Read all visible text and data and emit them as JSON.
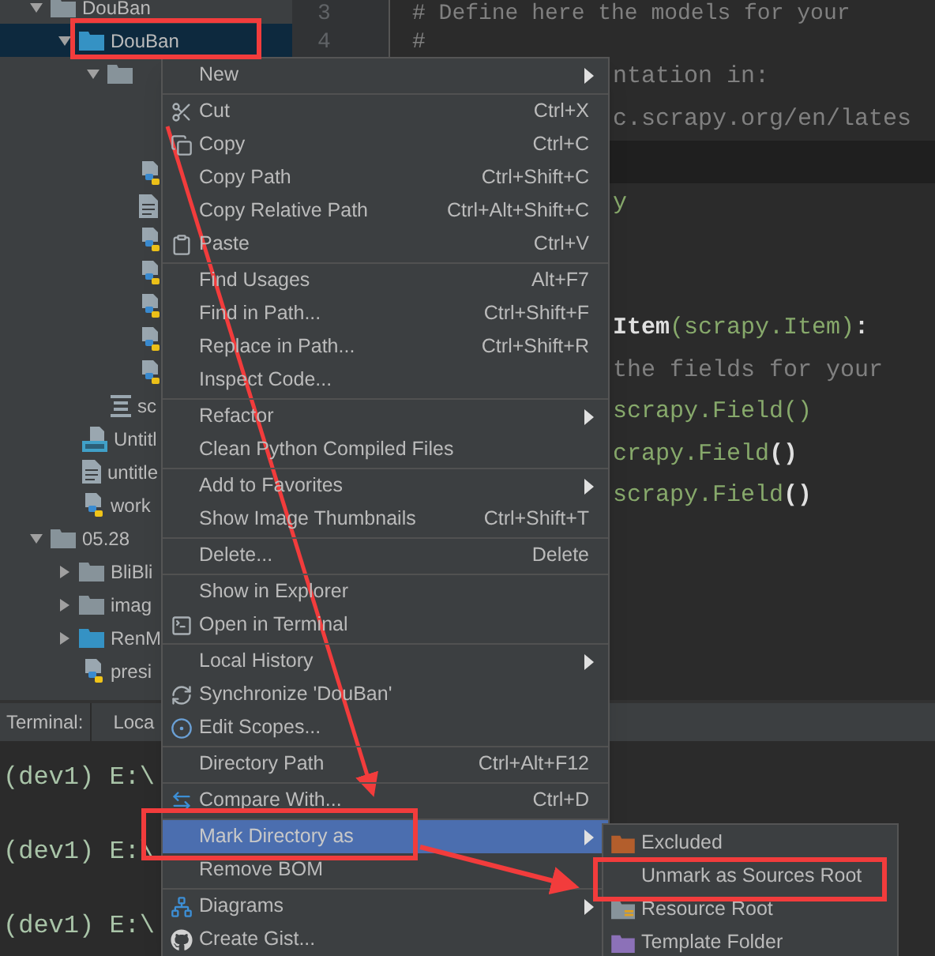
{
  "project_tree": [
    {
      "name": "DouBan",
      "kind": "folder",
      "expanded": true,
      "selected": false,
      "children": [
        {
          "name": "DouBan",
          "kind": "source-folder",
          "expanded": true,
          "selected": true,
          "children": [
            {
              "kind": "folder",
              "expanded": true,
              "selected": false,
              "children": [
                {
                  "kind": "covered"
                },
                {
                  "kind": "covered"
                },
                {
                  "kind": "python-file",
                  "selected": false
                },
                {
                  "kind": "text-file",
                  "selected": false
                },
                {
                  "kind": "python-file",
                  "selected": false
                },
                {
                  "kind": "python-file",
                  "selected": false
                },
                {
                  "kind": "python-file",
                  "selected": false
                },
                {
                  "kind": "python-file",
                  "selected": false
                },
                {
                  "kind": "python-file",
                  "selected": false
                }
              ]
            },
            {
              "name": "sc",
              "kind": "config-file",
              "selected": false
            }
          ]
        },
        {
          "name": "Untitl",
          "kind": "notebook-file",
          "selected": false
        },
        {
          "name": "untitle",
          "kind": "text-file",
          "selected": false
        },
        {
          "name": "work",
          "kind": "python-file",
          "selected": false
        }
      ]
    },
    {
      "name": "05.28",
      "kind": "folder",
      "expanded": true,
      "selected": false,
      "children": [
        {
          "name": "BliBli",
          "kind": "folder",
          "expanded": false,
          "selected": false
        },
        {
          "name": "imag",
          "kind": "folder",
          "expanded": false,
          "selected": false
        },
        {
          "name": "RenM",
          "kind": "source-folder",
          "expanded": false,
          "selected": false
        },
        {
          "name": "presi",
          "kind": "python-file",
          "selected": false
        }
      ]
    }
  ],
  "editor": {
    "lines": [
      {
        "number": "3",
        "covered": false,
        "current": false,
        "segments": [
          {
            "kind": "comment",
            "text": "# Define here the models for your"
          }
        ]
      },
      {
        "number": "4",
        "covered": false,
        "current": false,
        "segments": [
          {
            "kind": "comment",
            "text": "#"
          }
        ]
      },
      {
        "covered": true,
        "current": false,
        "segments": [
          {
            "kind": "comment",
            "text": "ntation in:"
          }
        ]
      },
      {
        "covered": true,
        "current": false,
        "segments": [
          {
            "kind": "comment",
            "text": "c.scrapy.org/en/lates"
          }
        ]
      },
      {
        "current": true
      },
      {
        "covered": true,
        "current": false,
        "segments": [
          {
            "kind": "plain",
            "text": "y"
          }
        ]
      },
      {
        "current": false
      },
      {
        "current": false
      },
      {
        "covered": true,
        "current": false,
        "segments": [
          {
            "kind": "class",
            "text": "Item"
          },
          {
            "kind": "plain",
            "text": "(scrapy.Item)"
          },
          {
            "kind": "class",
            "text": ":"
          }
        ]
      },
      {
        "covered": true,
        "current": false,
        "segments": [
          {
            "kind": "comment",
            "text": "the fields for your"
          }
        ]
      },
      {
        "covered": true,
        "current": false,
        "segments": [
          {
            "kind": "plain",
            "text": "scrapy.Field()"
          }
        ]
      },
      {
        "covered": true,
        "current": false,
        "segments": [
          {
            "kind": "plain",
            "text": "crapy.Field"
          },
          {
            "kind": "class",
            "text": "()"
          }
        ]
      },
      {
        "covered": true,
        "current": false,
        "segments": [
          {
            "kind": "plain",
            "text": "scrapy.Field"
          },
          {
            "kind": "class",
            "text": "()"
          }
        ]
      }
    ]
  },
  "terminal": {
    "title": "Terminal:",
    "tabs": [
      {
        "label": "Loca",
        "selected": true
      }
    ],
    "lines": [
      "(dev1) E:\\",
      "(dev1) E:\\",
      "(dev1) E:\\"
    ]
  },
  "context_menu": {
    "items": [
      {
        "kind": "item",
        "label": "New",
        "submenu": true,
        "selected": false
      },
      {
        "kind": "separator"
      },
      {
        "kind": "item",
        "label": "Cut",
        "shortcut": "Ctrl+X",
        "submenu": false,
        "selected": false
      },
      {
        "kind": "item",
        "label": "Copy",
        "shortcut": "Ctrl+C",
        "submenu": false,
        "selected": false
      },
      {
        "kind": "item",
        "label": "Copy Path",
        "shortcut": "Ctrl+Shift+C",
        "submenu": false,
        "selected": false
      },
      {
        "kind": "item",
        "label": "Copy Relative Path",
        "shortcut": "Ctrl+Alt+Shift+C",
        "submenu": false,
        "selected": false
      },
      {
        "kind": "item",
        "label": "Paste",
        "shortcut": "Ctrl+V",
        "submenu": false,
        "selected": false
      },
      {
        "kind": "separator"
      },
      {
        "kind": "item",
        "label": "Find Usages",
        "shortcut": "Alt+F7",
        "submenu": false,
        "selected": false
      },
      {
        "kind": "item",
        "label": "Find in Path...",
        "shortcut": "Ctrl+Shift+F",
        "submenu": false,
        "selected": false
      },
      {
        "kind": "item",
        "label": "Replace in Path...",
        "shortcut": "Ctrl+Shift+R",
        "submenu": false,
        "selected": false
      },
      {
        "kind": "item",
        "label": "Inspect Code...",
        "submenu": false,
        "selected": false
      },
      {
        "kind": "separator"
      },
      {
        "kind": "item",
        "label": "Refactor",
        "submenu": true,
        "selected": false
      },
      {
        "kind": "item",
        "label": "Clean Python Compiled Files",
        "submenu": false,
        "selected": false
      },
      {
        "kind": "separator"
      },
      {
        "kind": "item",
        "label": "Add to Favorites",
        "submenu": true,
        "selected": false
      },
      {
        "kind": "item",
        "label": "Show Image Thumbnails",
        "shortcut": "Ctrl+Shift+T",
        "submenu": false,
        "selected": false
      },
      {
        "kind": "separator"
      },
      {
        "kind": "item",
        "label": "Delete...",
        "shortcut": "Delete",
        "submenu": false,
        "selected": false
      },
      {
        "kind": "separator"
      },
      {
        "kind": "item",
        "label": "Show in Explorer",
        "submenu": false,
        "selected": false
      },
      {
        "kind": "item",
        "label": "Open in Terminal",
        "submenu": false,
        "selected": false
      },
      {
        "kind": "separator"
      },
      {
        "kind": "item",
        "label": "Local History",
        "submenu": true,
        "selected": false
      },
      {
        "kind": "item",
        "label": "Synchronize 'DouBan'",
        "submenu": false,
        "selected": false
      },
      {
        "kind": "item",
        "label": "Edit Scopes...",
        "submenu": false,
        "selected": false
      },
      {
        "kind": "separator"
      },
      {
        "kind": "item",
        "label": "Directory Path",
        "shortcut": "Ctrl+Alt+F12",
        "submenu": false,
        "selected": false
      },
      {
        "kind": "separator"
      },
      {
        "kind": "item",
        "label": "Compare With...",
        "shortcut": "Ctrl+D",
        "submenu": false,
        "selected": false
      },
      {
        "kind": "separator"
      },
      {
        "kind": "item",
        "label": "Mark Directory as",
        "submenu": true,
        "selected": true
      },
      {
        "kind": "item",
        "label": "Remove BOM",
        "submenu": false,
        "selected": false
      },
      {
        "kind": "separator"
      },
      {
        "kind": "item",
        "label": "Diagrams",
        "submenu": true,
        "selected": false
      },
      {
        "kind": "item",
        "label": "Create Gist...",
        "submenu": false,
        "selected": false
      }
    ]
  },
  "submenu": {
    "items": [
      {
        "label": "Excluded",
        "selected": false
      },
      {
        "label": "Unmark as Sources Root",
        "selected": false
      },
      {
        "label": "Resource Root",
        "selected": false
      },
      {
        "label": "Template Folder",
        "selected": false
      }
    ]
  }
}
